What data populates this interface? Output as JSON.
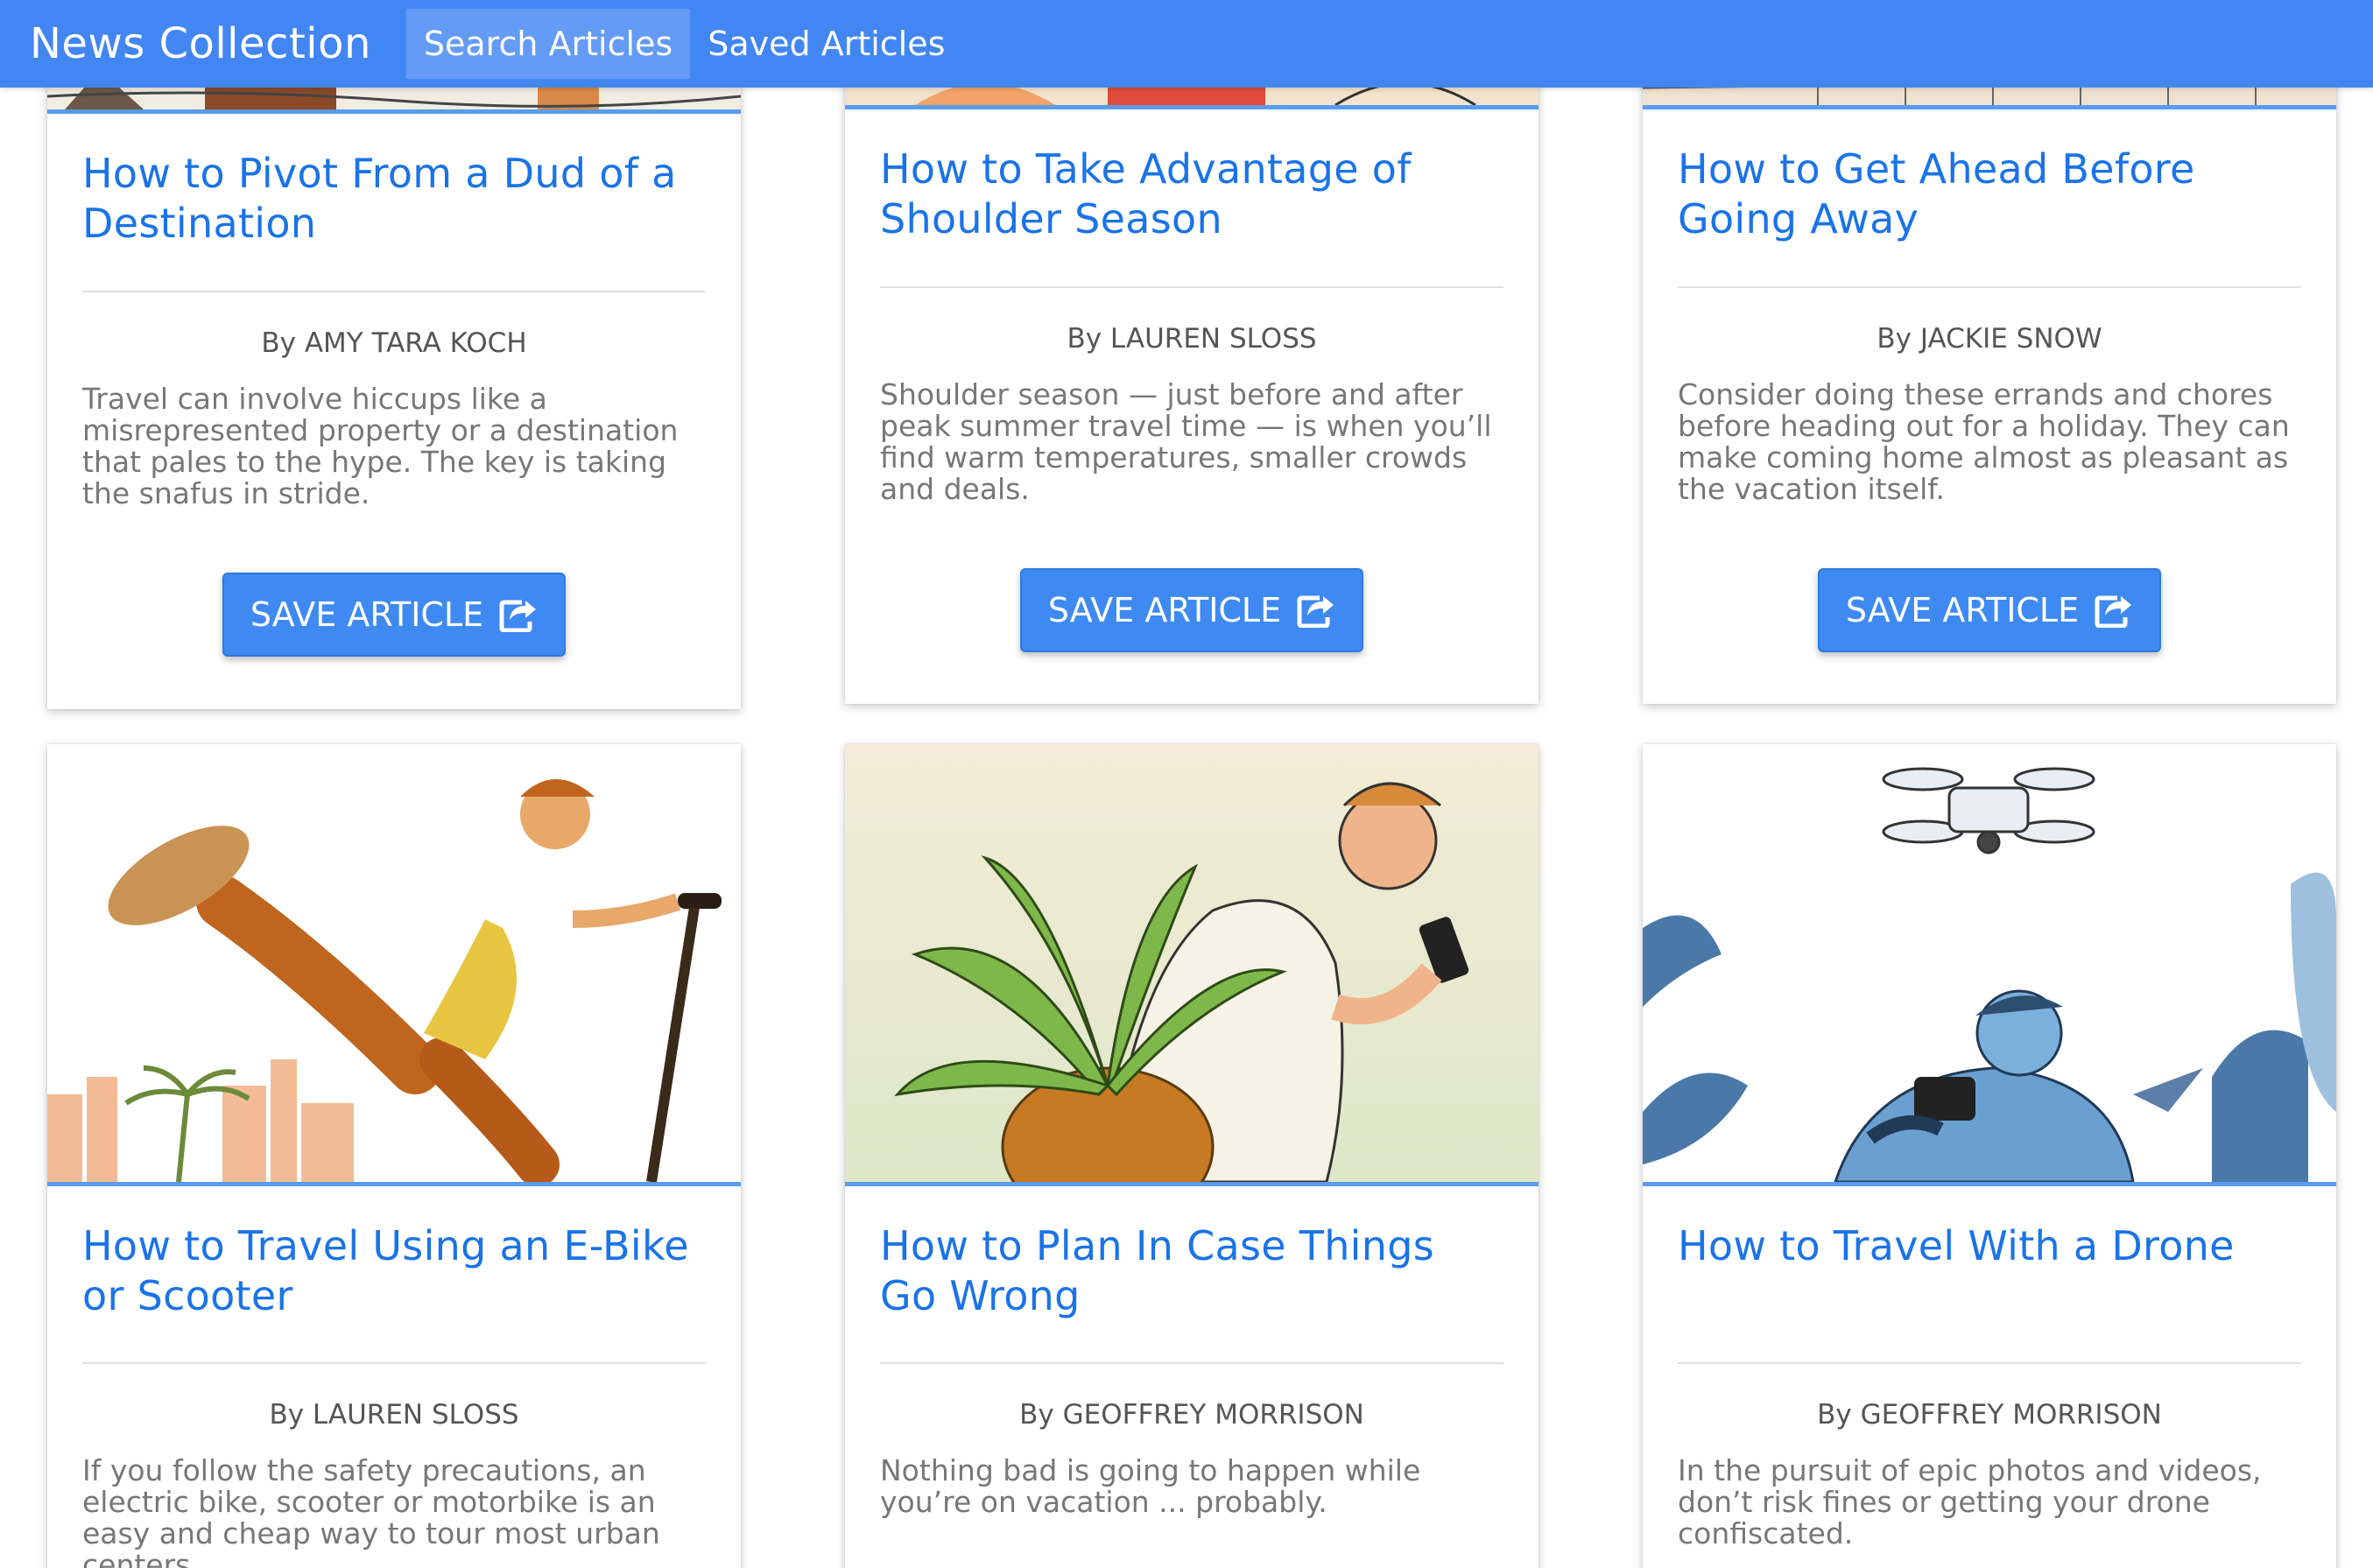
{
  "navbar": {
    "brand": "News Collection",
    "links": [
      {
        "label": "Search Articles"
      },
      {
        "label": "Saved Articles"
      }
    ]
  },
  "articles": [
    {
      "title": "How to Pivot From a Dud of a Destination",
      "author": "By AMY TARA KOCH",
      "description": "Travel can involve hiccups like a misrepresented property or a destination that pales to the hype. The key is taking the snafus in stride.",
      "button_label": "SAVE ARTICLE"
    },
    {
      "title": "How to Take Advantage of Shoulder Season",
      "author": "By LAUREN SLOSS",
      "description": "Shoulder season — just before and after peak summer travel time — is when you’ll find warm temperatures, smaller crowds and deals.",
      "button_label": "SAVE ARTICLE"
    },
    {
      "title": "How to Get Ahead Before Going Away",
      "author": "By JACKIE SNOW",
      "description": "Consider doing these errands and chores before heading out for a holiday. They can make coming home almost as pleasant as the vacation itself.",
      "button_label": "SAVE ARTICLE"
    },
    {
      "title": "How to Travel Using an E-Bike or Scooter",
      "author": "By LAUREN SLOSS",
      "description": "If you follow the safety precautions, an electric bike, scooter or motorbike is an easy and cheap way to tour most urban centers."
    },
    {
      "title": "How to Plan In Case Things Go Wrong",
      "author": "By GEOFFREY MORRISON",
      "description": "Nothing bad is going to happen while you’re on vacation ... probably."
    },
    {
      "title": "How to Travel With a Drone",
      "author": "By GEOFFREY MORRISON",
      "description": "In the pursuit of epic photos and videos, don’t risk fines or getting your drone confiscated."
    }
  ],
  "colors": {
    "navbar": "#4286f4",
    "title": "#1a73e8",
    "button": "#3f8af2"
  }
}
